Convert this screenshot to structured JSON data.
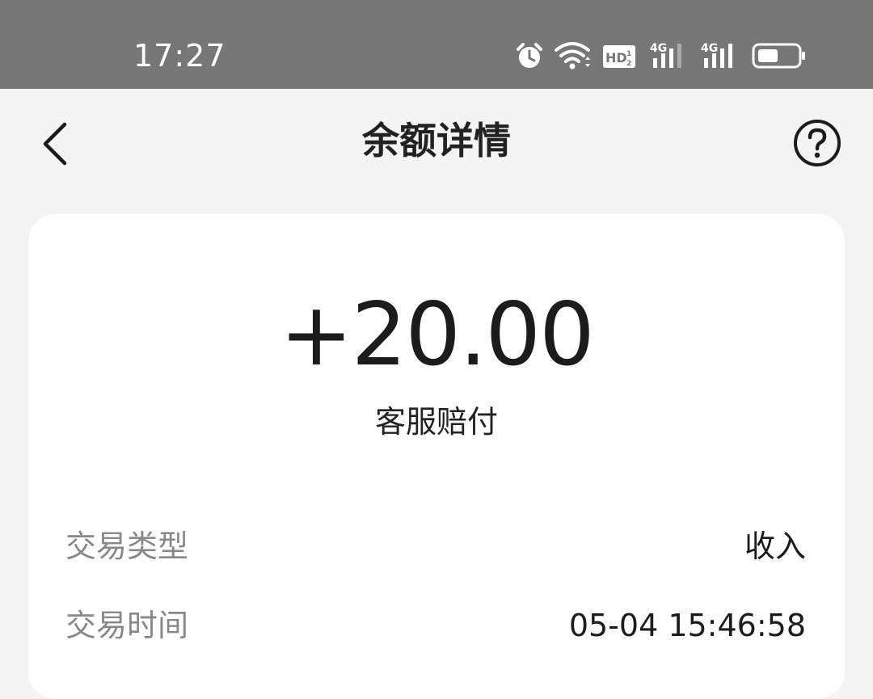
{
  "status_bar": {
    "time": "17:27",
    "icons": [
      "alarm-icon",
      "wifi-icon",
      "hd-icon",
      "signal-4g-icon",
      "signal-4g-icon",
      "battery-icon"
    ],
    "hd_label": "HD",
    "network_1": "4G",
    "network_2": "4G"
  },
  "nav": {
    "title": "余额详情",
    "back_icon": "chevron-left-icon",
    "help_icon": "question-circle-icon"
  },
  "transaction": {
    "amount": "+20.00",
    "description": "客服赔付",
    "details": [
      {
        "label": "交易类型",
        "value": "收入"
      },
      {
        "label": "交易时间",
        "value": "05-04 15:46:58"
      }
    ]
  },
  "colors": {
    "status_bar_bg": "#777777",
    "page_bg": "#f4f4f4",
    "card_bg": "#ffffff",
    "label_text": "#888888",
    "primary_text": "#1c1c1c"
  }
}
